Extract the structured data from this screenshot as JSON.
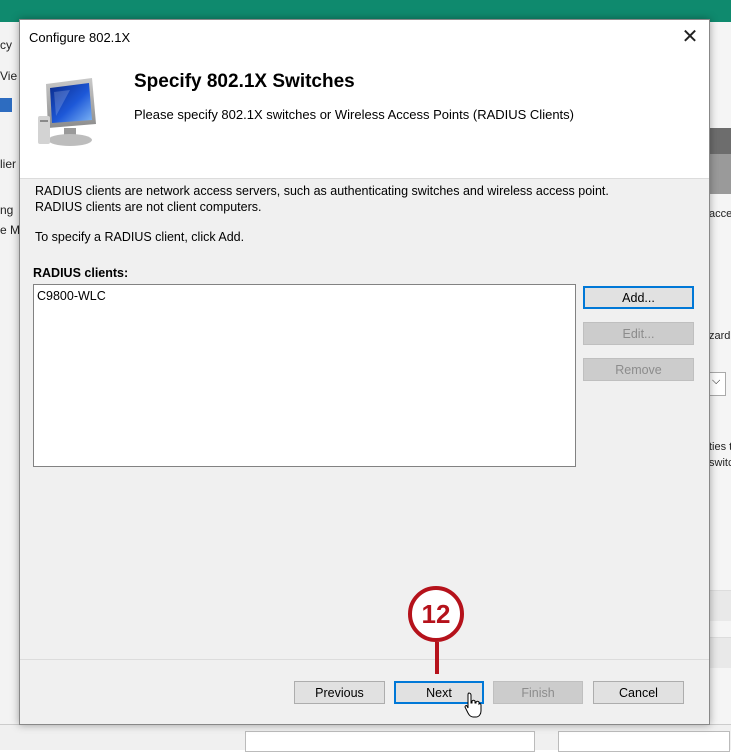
{
  "background": {
    "left_fragments": [
      "cy",
      "Vie",
      "lier",
      "ng",
      "e M"
    ],
    "right_fragments": [
      "acce",
      "zard",
      "ties t",
      "switc"
    ]
  },
  "dialog": {
    "title": "Configure 802.1X",
    "close_glyph": "✕",
    "heading": "Specify 802.1X Switches",
    "subheading": "Please specify 802.1X switches or Wireless Access Points (RADIUS Clients)",
    "description_line1": "RADIUS clients are network access servers, such as authenticating switches and wireless access point.",
    "description_line2": "RADIUS clients are not client computers.",
    "instruction": "To specify a RADIUS client, click Add.",
    "clients_label": "RADIUS clients:",
    "clients": [
      "C9800-WLC"
    ],
    "buttons": {
      "add": "Add...",
      "edit": "Edit...",
      "remove": "Remove",
      "previous": "Previous",
      "next": "Next",
      "finish": "Finish",
      "cancel": "Cancel"
    }
  },
  "callout": {
    "number": "12",
    "color": "#b5121b"
  },
  "colors": {
    "accent": "#0078d7",
    "topbar": "#0f8a6e"
  }
}
